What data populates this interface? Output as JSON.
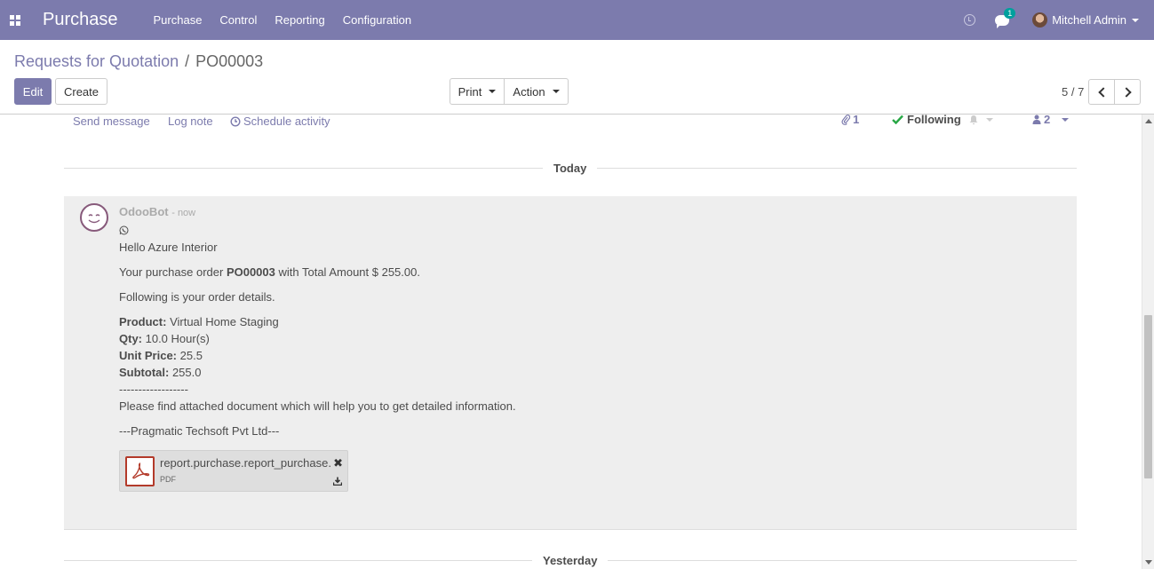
{
  "navbar": {
    "brand": "Purchase",
    "menu": [
      "Purchase",
      "Control",
      "Reporting",
      "Configuration"
    ],
    "chat_badge": "1",
    "user_name": "Mitchell Admin"
  },
  "breadcrumb": {
    "parent": "Requests for Quotation",
    "separator": "/",
    "current": "PO00003"
  },
  "buttons": {
    "edit": "Edit",
    "create": "Create",
    "print": "Print",
    "action": "Action"
  },
  "pager": {
    "value": "5 / 7"
  },
  "chatter": {
    "send_message": "Send message",
    "log_note": "Log note",
    "schedule_activity": "Schedule activity",
    "attachment_count": "1",
    "following": "Following",
    "follower_count": "2"
  },
  "separators": {
    "today": "Today",
    "yesterday": "Yesterday"
  },
  "message": {
    "author": "OdooBot",
    "time": "- now",
    "greeting": "Hello Azure Interior",
    "order_prefix": "Your purchase order ",
    "order_ref": "PO00003",
    "order_suffix": " with Total Amount $ 255.00.",
    "details_intro": "Following is your order details.",
    "product_label": "Product:",
    "product_value": " Virtual Home Staging",
    "qty_label": "Qty:",
    "qty_value": " 10.0 Hour(s)",
    "price_label": "Unit Price:",
    "price_value": " 25.5",
    "subtotal_label": "Subtotal:",
    "subtotal_value": " 255.0",
    "dashes": "------------------",
    "attached_note": "Please find attached document which will help you to get detailed information.",
    "signature": "---Pragmatic Techsoft Pvt Ltd---"
  },
  "attachment": {
    "name": "report.purchase.report_purchase.",
    "type": "PDF"
  },
  "colors": {
    "brand": "#7c7bad",
    "following_check": "#28a745",
    "pdf_red": "#b33a2a"
  }
}
